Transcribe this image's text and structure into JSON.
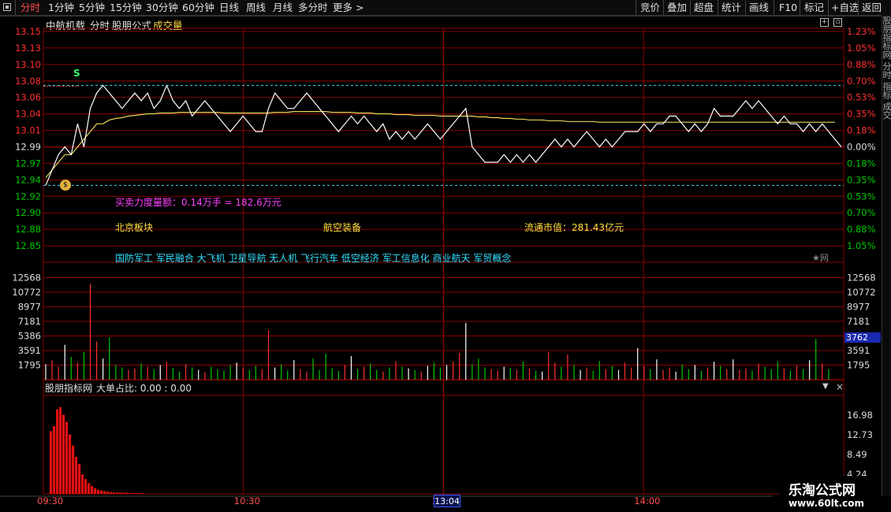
{
  "toolbar": {
    "left_items": [
      "分时",
      "1分钟",
      "5分钟",
      "15分钟",
      "30分钟",
      "60分钟",
      "日线",
      "周线",
      "月线",
      "多分时",
      "更多 >"
    ],
    "right_items": [
      "竞价",
      "叠加",
      "超盘",
      "统计",
      "画线",
      "F10",
      "标记",
      "+自选",
      "返回"
    ]
  },
  "title": {
    "stock_name": "中航机载",
    "mode": "分时",
    "formula": "股朋公式",
    "indicator": "成交量"
  },
  "price_axis": {
    "left": [
      "13.15",
      "13.13",
      "13.10",
      "13.08",
      "13.06",
      "13.04",
      "13.01",
      "12.99",
      "12.97",
      "12.94",
      "12.92",
      "12.90",
      "12.88",
      "12.85"
    ],
    "right": [
      "1.23%",
      "1.05%",
      "0.88%",
      "0.70%",
      "0.53%",
      "0.35%",
      "0.18%",
      "0.00%",
      "0.18%",
      "0.35%",
      "0.53%",
      "0.70%",
      "0.88%",
      "1.05%"
    ],
    "prev_close": 12.99,
    "max": 13.15,
    "min": 12.85
  },
  "volume_axis": {
    "labels": [
      "12568",
      "10772",
      "8977",
      "7181",
      "5386",
      "3591",
      "1795"
    ],
    "max": 14364,
    "current_volume": "3762"
  },
  "indicator_axis": {
    "labels": [
      "16.98",
      "12.73",
      "8.49",
      "4.24"
    ],
    "max": 21.2
  },
  "overlay": {
    "force_text": "买卖力度量额：0.14万手 = 182.6万元",
    "sector": "北京板块",
    "industry": "航空装备",
    "market_cap": "流通市值：281.43亿元",
    "concepts": "国防军工 军民融合 大飞机 卫星导航 无人机 飞行汽车 低空经济 军工信息化 商业航天 军贸概念",
    "web_mark": "★网",
    "sell_marker": "S"
  },
  "indicator_panel": {
    "title": "股朋指标网",
    "ratio_text": "大单占比: 0.00 : 0.00"
  },
  "time_axis": {
    "labels": [
      "09:30",
      "10:30",
      "13",
      "14:00"
    ],
    "cursor": "13:04"
  },
  "watermark": {
    "line1": "乐淘公式网",
    "line2": "www.60lt.com"
  },
  "side_text": "股朋指标网 分时 指标 成交",
  "colors": {
    "up": "#ff3030",
    "down": "#00c800",
    "price_line": "#ffffff",
    "avg_line": "#e8d85a",
    "grid": "#8a0000",
    "cyan": "#33e0ff",
    "magenta": "#ff40ff",
    "yellow": "#ffe040"
  },
  "chart_data": {
    "type": "line",
    "series": [
      {
        "name": "price",
        "values": [
          12.95,
          12.97,
          12.99,
          13.0,
          12.99,
          13.03,
          13.0,
          13.05,
          13.07,
          13.08,
          13.07,
          13.06,
          13.05,
          13.06,
          13.07,
          13.06,
          13.07,
          13.05,
          13.06,
          13.08,
          13.06,
          13.05,
          13.06,
          13.04,
          13.05,
          13.06,
          13.05,
          13.04,
          13.03,
          13.02,
          13.03,
          13.04,
          13.03,
          13.02,
          13.02,
          13.05,
          13.07,
          13.06,
          13.05,
          13.05,
          13.06,
          13.07,
          13.06,
          13.05,
          13.04,
          13.03,
          13.02,
          13.03,
          13.04,
          13.03,
          13.04,
          13.03,
          13.02,
          13.03,
          13.01,
          13.02,
          13.01,
          13.02,
          13.01,
          13.02,
          13.03,
          13.02,
          13.01,
          13.02,
          13.03,
          13.04,
          13.05,
          13.0,
          12.99,
          12.98,
          12.98,
          12.98,
          12.99,
          12.98,
          12.99,
          12.98,
          12.99,
          12.98,
          12.99,
          13.0,
          13.01,
          13.0,
          13.01,
          13.0,
          13.01,
          13.02,
          13.01,
          13.0,
          13.01,
          13.0,
          13.01,
          13.02,
          13.02,
          13.02,
          13.03,
          13.02,
          13.03,
          13.03,
          13.04,
          13.04,
          13.03,
          13.02,
          13.03,
          13.02,
          13.03,
          13.05,
          13.04,
          13.04,
          13.04,
          13.05,
          13.06,
          13.05,
          13.06,
          13.05,
          13.04,
          13.03,
          13.04,
          13.03,
          13.03,
          13.02,
          13.03,
          13.02,
          13.03,
          13.02,
          13.01,
          13.0
        ]
      },
      {
        "name": "avg",
        "values": [
          12.96,
          12.97,
          12.98,
          12.99,
          12.99,
          13.0,
          13.01,
          13.02,
          13.03,
          13.03,
          13.035,
          13.037,
          13.038,
          13.04,
          13.041,
          13.042,
          13.043,
          13.043,
          13.044,
          13.044,
          13.044,
          13.045,
          13.045,
          13.045,
          13.045,
          13.045,
          13.045,
          13.045,
          13.044,
          13.044,
          13.044,
          13.044,
          13.044,
          13.044,
          13.044,
          13.044,
          13.045,
          13.045,
          13.045,
          13.046,
          13.046,
          13.046,
          13.046,
          13.046,
          13.046,
          13.045,
          13.045,
          13.045,
          13.045,
          13.044,
          13.044,
          13.044,
          13.043,
          13.043,
          13.043,
          13.042,
          13.042,
          13.042,
          13.041,
          13.041,
          13.041,
          13.041,
          13.04,
          13.04,
          13.04,
          13.04,
          13.04,
          13.04,
          13.039,
          13.039,
          13.038,
          13.038,
          13.037,
          13.037,
          13.036,
          13.036,
          13.035,
          13.035,
          13.035,
          13.034,
          13.034,
          13.034,
          13.033,
          13.033,
          13.033,
          13.033,
          13.033,
          13.032,
          13.032,
          13.032,
          13.032,
          13.032,
          13.032,
          13.032,
          13.032,
          13.032,
          13.032,
          13.032,
          13.032,
          13.032,
          13.032,
          13.032,
          13.032,
          13.032,
          13.032,
          13.032,
          13.032,
          13.032,
          13.032,
          13.032,
          13.032,
          13.032,
          13.032,
          13.032,
          13.032,
          13.032,
          13.032,
          13.032,
          13.032,
          13.032,
          13.032,
          13.032,
          13.032,
          13.032,
          13.032
        ]
      }
    ],
    "volumes": [
      1900,
      2400,
      1600,
      4300,
      2800,
      2100,
      3400,
      11800,
      4700,
      2600,
      5200,
      1800,
      1500,
      1200,
      1400,
      2000,
      1600,
      1300,
      1800,
      2200,
      1400,
      1000,
      1900,
      1500,
      1200,
      900,
      1600,
      1300,
      1100,
      1800,
      2100,
      1500,
      1200,
      1700,
      1300,
      6100,
      1500,
      1900,
      1100,
      2400,
      1300,
      1000,
      2600,
      1200,
      3200,
      1400,
      1100,
      1800,
      2900,
      1300,
      1600,
      2000,
      1200,
      1000,
      1500,
      2300,
      1600,
      1400,
      1200,
      1000,
      1700,
      2100,
      1500,
      1800,
      2200,
      3300,
      7000,
      1900,
      2600,
      1500,
      1300,
      1100,
      1600,
      1400,
      1200,
      2200,
      1400,
      1100,
      1000,
      3400,
      2100,
      1600,
      3100,
      1800,
      1200,
      1500,
      1100,
      2300,
      1300,
      1700,
      1200,
      2100,
      1500,
      3900,
      1700,
      1300,
      2500,
      1200,
      1500,
      1000,
      1900,
      1300,
      1800,
      1100,
      1500,
      2200,
      1700,
      1300,
      2500,
      1200,
      1400,
      1100,
      2000,
      1600,
      1300,
      2200,
      1400,
      1100,
      1700,
      1300,
      2400,
      5000,
      2000,
      1300
    ]
  }
}
